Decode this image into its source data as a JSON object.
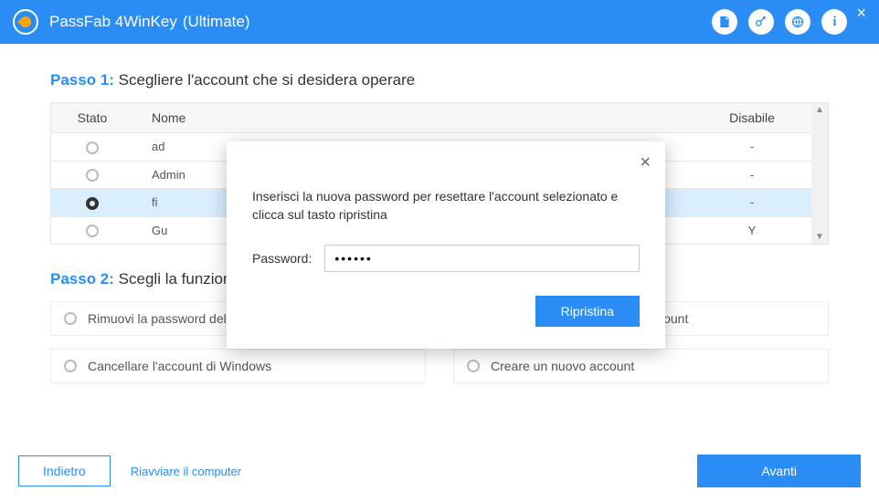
{
  "app": {
    "title": "PassFab 4WinKey",
    "edition": "(Ultimate)"
  },
  "step1": {
    "num": "Passo 1:",
    "text": "Scegliere l'account che si desidera operare",
    "headers": {
      "stato": "Stato",
      "nome": "Nome",
      "disable": "Disabile"
    },
    "rows": [
      {
        "name": "ad",
        "disable": "-",
        "checked": false
      },
      {
        "name": "Admin",
        "disable": "-",
        "checked": false
      },
      {
        "name": "fi",
        "disable": "-",
        "checked": true
      },
      {
        "name": "Gu",
        "disable": "Y",
        "checked": false
      }
    ]
  },
  "step2": {
    "num": "Passo 2:",
    "text": "Scegli la funzion",
    "options": {
      "remove": "Rimuovi la password dell'account",
      "reset": "Ripristina la password dell'account",
      "delete": "Cancellare l'account di Windows",
      "create": "Creare un nuovo account"
    }
  },
  "footer": {
    "back": "Indietro",
    "restart": "Riavviare il computer",
    "next": "Avanti"
  },
  "modal": {
    "message": "Inserisci la nuova password per resettare l'account selezionato e clicca sul tasto  ripristina",
    "password_label": "Password:",
    "password_value": "••••••",
    "submit": "Ripristina"
  }
}
